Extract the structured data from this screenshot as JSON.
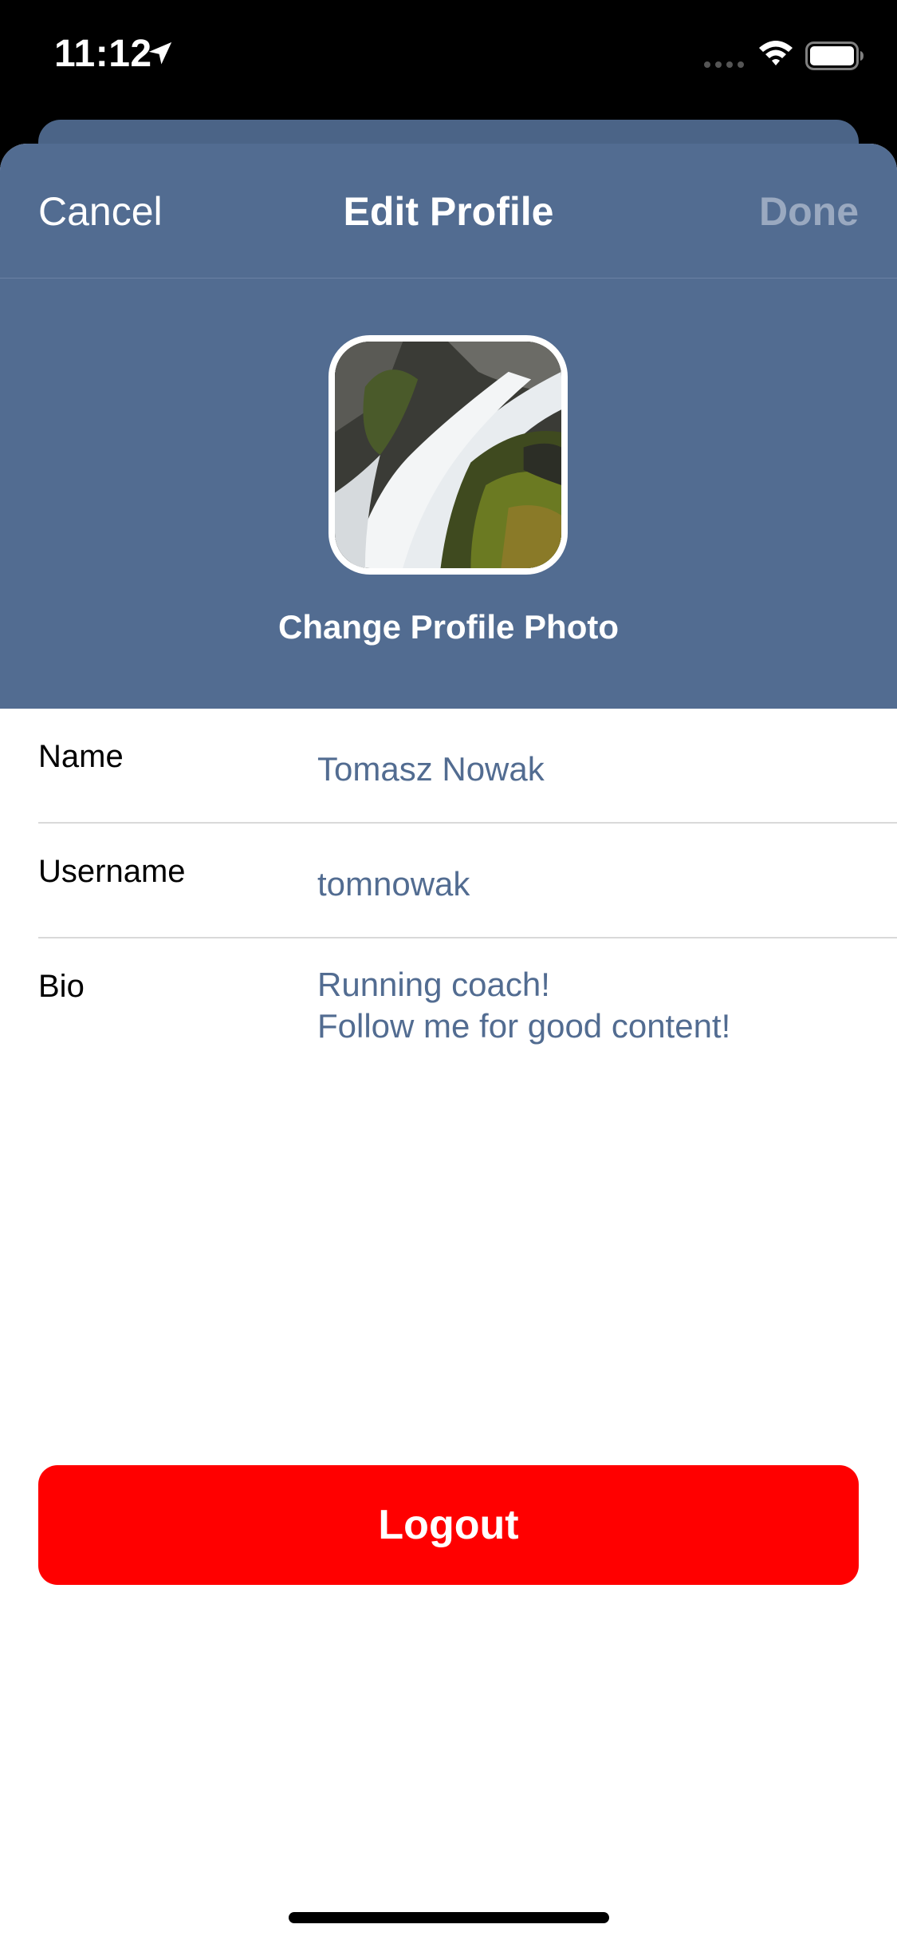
{
  "status_bar": {
    "time": "11:12"
  },
  "nav": {
    "cancel_label": "Cancel",
    "title": "Edit Profile",
    "done_label": "Done"
  },
  "profile": {
    "change_photo_label": "Change Profile Photo"
  },
  "form": {
    "name": {
      "label": "Name",
      "value": "Tomasz Nowak"
    },
    "username": {
      "label": "Username",
      "value": "tomnowak"
    },
    "bio": {
      "label": "Bio",
      "line1": "Running coach!",
      "line2": "Follow me for good content!"
    }
  },
  "logout_label": "Logout",
  "colors": {
    "header_bg": "#526c91",
    "value_text": "#526c91",
    "done_disabled": "#9aa9c0",
    "logout_bg": "#ff0000"
  },
  "icons": [
    "location-arrow-icon",
    "cellular-signal-icon",
    "wifi-icon",
    "battery-icon"
  ]
}
